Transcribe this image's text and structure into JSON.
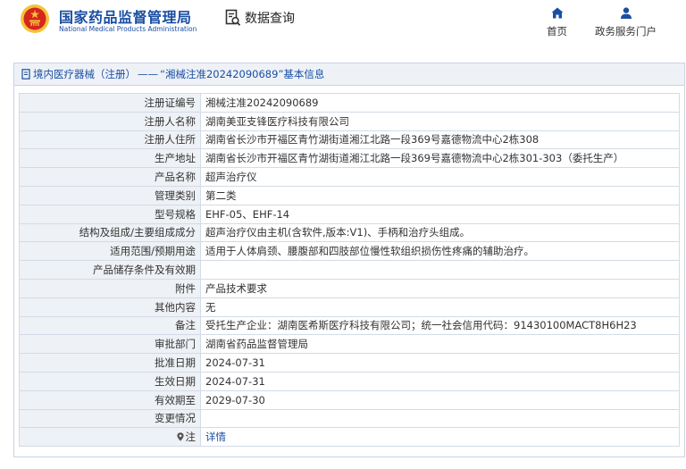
{
  "header": {
    "org_name_cn": "国家药品监督管理局",
    "org_name_en": "National Medical Products Administration",
    "query_label": "数据查询",
    "nav": [
      {
        "label": "首页",
        "icon": "home-icon"
      },
      {
        "label": "政务服务门户",
        "icon": "user-icon"
      }
    ]
  },
  "panel": {
    "breadcrumb_link": "境内医疗器械（注册）",
    "breadcrumb_sep": "——",
    "breadcrumb_title": "“湘械注准20242090689”基本信息"
  },
  "rows": [
    {
      "key": "注册证编号",
      "value": "湘械注准20242090689"
    },
    {
      "key": "注册人名称",
      "value": "湖南美亚支锋医疗科技有限公司"
    },
    {
      "key": "注册人住所",
      "value": "湖南省长沙市开福区青竹湖街道湘江北路一段369号嘉德物流中心2栋308"
    },
    {
      "key": "生产地址",
      "value": "湖南省长沙市开福区青竹湖街道湘江北路一段369号嘉德物流中心2栋301-303（委托生产）"
    },
    {
      "key": "产品名称",
      "value": "超声治疗仪"
    },
    {
      "key": "管理类别",
      "value": "第二类"
    },
    {
      "key": "型号规格",
      "value": "EHF-05、EHF-14"
    },
    {
      "key": "结构及组成/主要组成成分",
      "value": "超声治疗仪由主机(含软件,版本:V1)、手柄和治疗头组成。"
    },
    {
      "key": "适用范围/预期用途",
      "value": "适用于人体肩颈、腰腹部和四肢部位慢性软组织损伤性疼痛的辅助治疗。"
    },
    {
      "key": "产品储存条件及有效期",
      "value": ""
    },
    {
      "key": "附件",
      "value": "产品技术要求"
    },
    {
      "key": "其他内容",
      "value": "无"
    },
    {
      "key": "备注",
      "value": "受托生产企业：湖南医希斯医疗科技有限公司；统一社会信用代码：91430100MACT8H6H23"
    },
    {
      "key": "审批部门",
      "value": "湖南省药品监督管理局"
    },
    {
      "key": "批准日期",
      "value": "2024-07-31"
    },
    {
      "key": "生效日期",
      "value": "2024-07-31"
    },
    {
      "key": "有效期至",
      "value": "2029-07-30"
    },
    {
      "key": "变更情况",
      "value": ""
    }
  ],
  "note_row": {
    "key": "注",
    "value": "详情"
  },
  "colors": {
    "brand_blue": "#1a4ea3",
    "emblem_red": "#d7261e",
    "emblem_gold": "#f3c43a"
  }
}
